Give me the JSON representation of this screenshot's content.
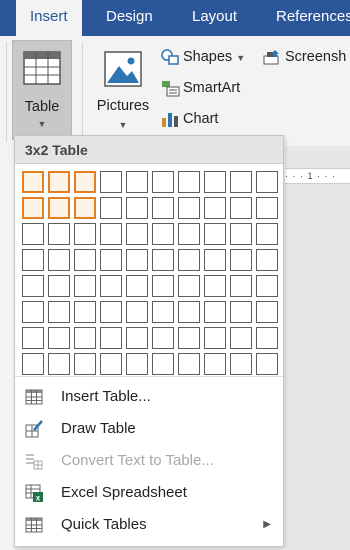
{
  "ribbon": {
    "tabs": [
      {
        "label": "Insert",
        "active": true
      },
      {
        "label": "Design",
        "active": false
      },
      {
        "label": "Layout",
        "active": false
      },
      {
        "label": "References",
        "active": false
      }
    ],
    "table_button": {
      "label": "Table"
    },
    "pictures_button": {
      "label": "Pictures"
    },
    "shapes_button": {
      "label": "Shapes"
    },
    "smartart_button": {
      "label": "SmartArt"
    },
    "chart_button": {
      "label": "Chart"
    },
    "screenshot_button": {
      "label": "Screensh"
    },
    "accent_color": "#2b579a"
  },
  "ruler": {
    "text": "· · · 1 · · ·"
  },
  "dropdown": {
    "header": "3x2 Table",
    "grid": {
      "columns": 10,
      "rows": 8,
      "selected_columns": 3,
      "selected_rows": 2
    },
    "menu": [
      {
        "label": "Insert Table...",
        "icon": "insert-table-icon",
        "enabled": true
      },
      {
        "label": "Draw Table",
        "icon": "draw-table-icon",
        "enabled": true
      },
      {
        "label": "Convert Text to Table...",
        "icon": "convert-text-icon",
        "enabled": false
      },
      {
        "label": "Excel Spreadsheet",
        "icon": "excel-icon",
        "enabled": true
      },
      {
        "label": "Quick Tables",
        "icon": "quick-tables-icon",
        "enabled": true,
        "submenu": true
      }
    ],
    "selection_color": "#e67e22"
  }
}
